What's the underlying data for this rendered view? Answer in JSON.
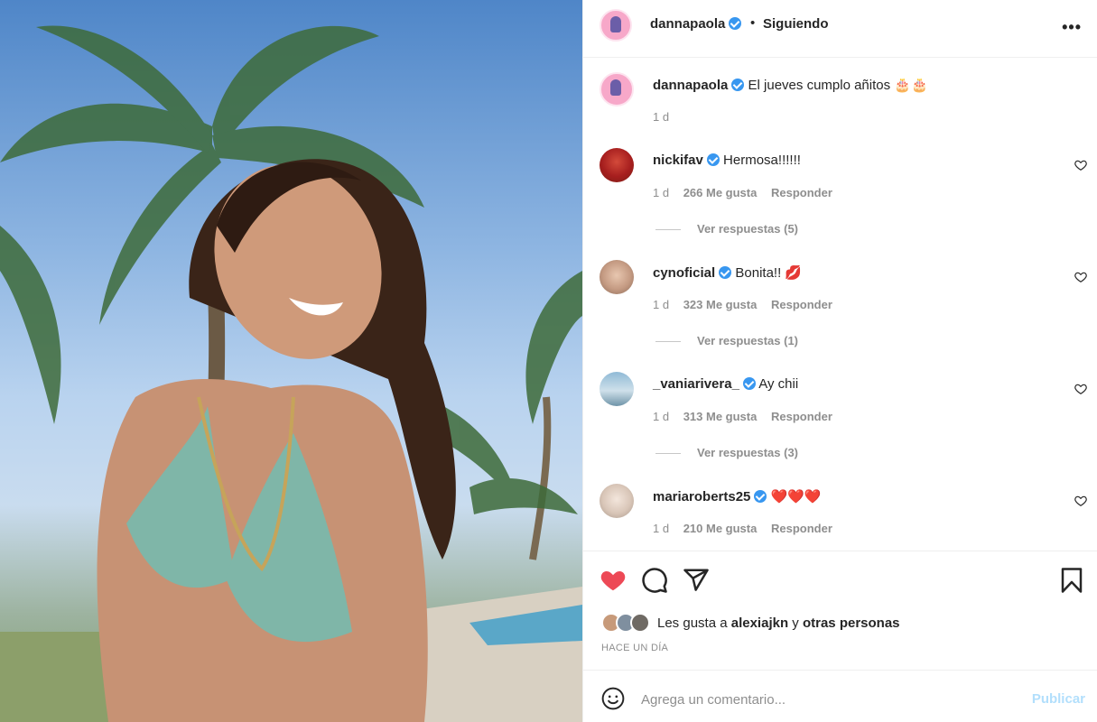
{
  "post": {
    "photo_alt": "",
    "author": "dannapaola",
    "follow_status": "Siguiendo",
    "dot": "•",
    "more_icon": "more-options-icon",
    "caption": {
      "username": "dannapaola",
      "text": "El jueves cumplo añitos 🎂🎂",
      "time": "1 d"
    }
  },
  "comments": [
    {
      "username": "nickifav",
      "text": "Hermosa!!!!!!",
      "time": "1 d",
      "likes": "266 Me gusta",
      "reply": "Responder",
      "replies": "Ver respuestas (5)"
    },
    {
      "username": "cynoficial",
      "text": "Bonita!! 💋",
      "time": "1 d",
      "likes": "323 Me gusta",
      "reply": "Responder",
      "replies": "Ver respuestas (1)"
    },
    {
      "username": "_vaniarivera_",
      "text": "Ay chii",
      "time": "1 d",
      "likes": "313 Me gusta",
      "reply": "Responder",
      "replies": "Ver respuestas (3)"
    },
    {
      "username": "mariaroberts25",
      "text": "❤️❤️❤️",
      "time": "1 d",
      "likes": "210 Me gusta",
      "reply": "Responder",
      "replies": ""
    }
  ],
  "actions": {
    "liked": true,
    "like_color": "#ed4956",
    "likes_prefix": "Les gusta a",
    "likes_user": "alexiajkn",
    "likes_and": "y",
    "likes_others": "otras personas",
    "time_ago": "HACE UN DÍA"
  },
  "composer": {
    "placeholder": "Agrega un comentario...",
    "publish_label": "Publicar"
  }
}
